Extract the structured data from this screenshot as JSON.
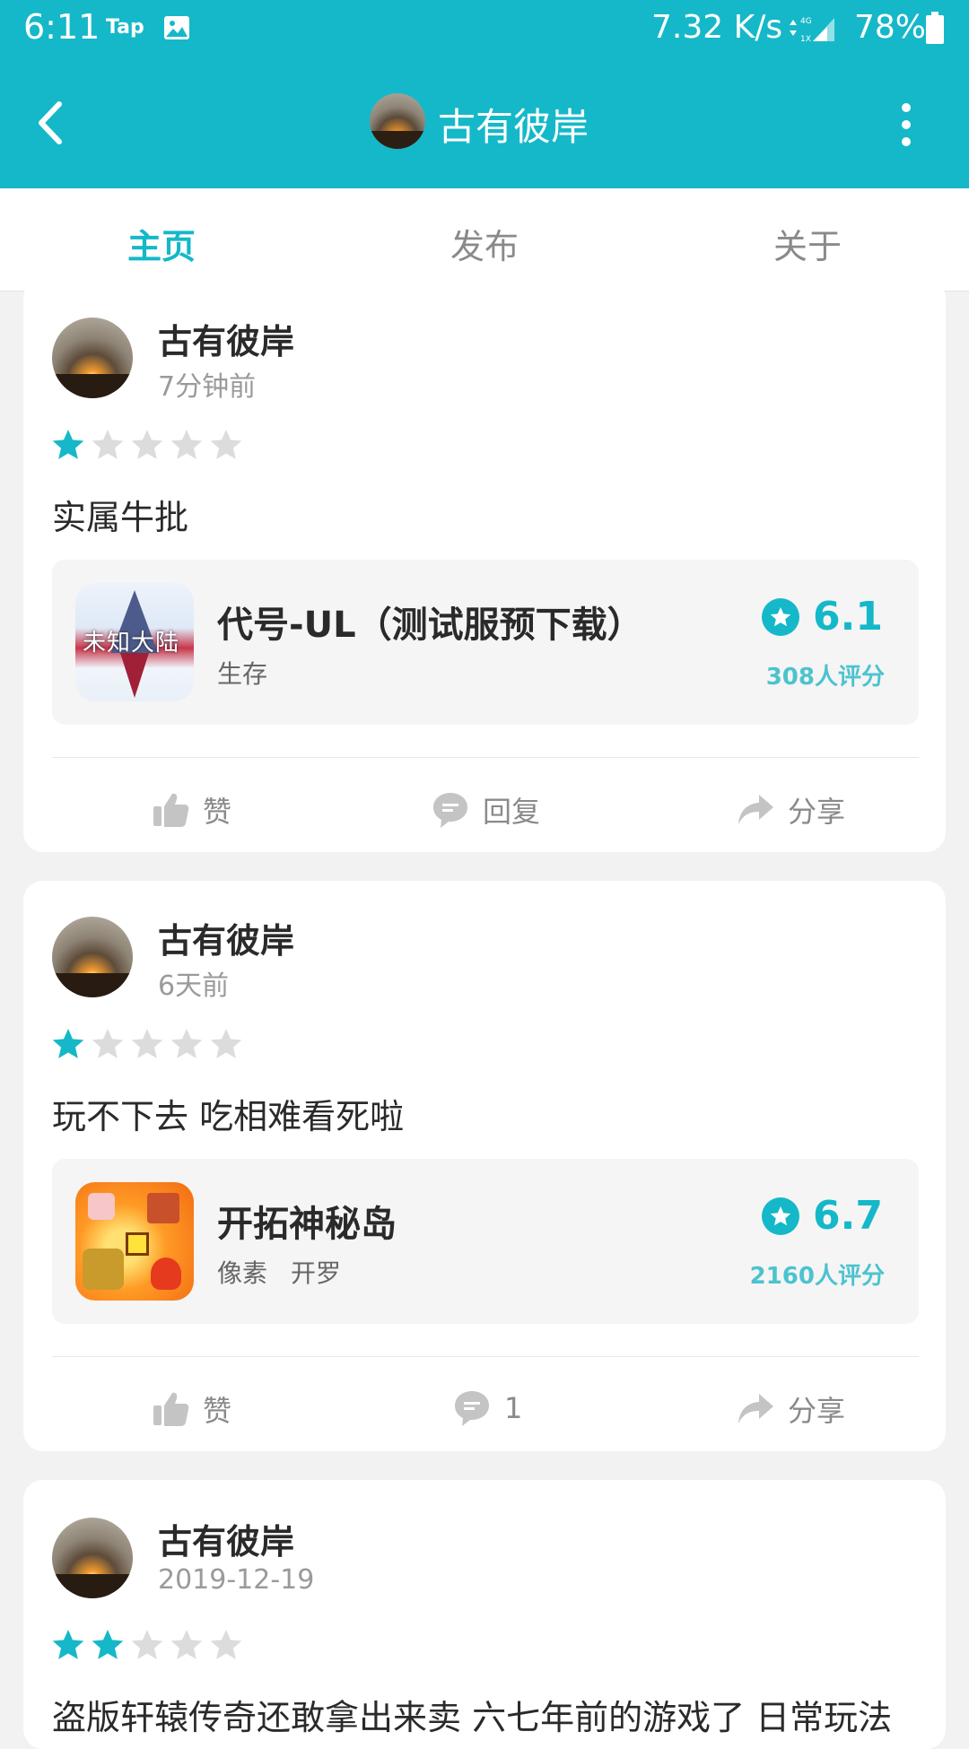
{
  "status_bar": {
    "time": "6:11",
    "tap_label": "Tap",
    "net_speed": "7.32 K/s",
    "battery": "78%",
    "icons": [
      "image-icon",
      "network-signal-icon",
      "battery-icon"
    ]
  },
  "toolbar": {
    "title": "古有彼岸",
    "icons": [
      "back-arrow-icon",
      "avatar",
      "more-vertical-icon"
    ]
  },
  "tabs": [
    {
      "label": "主页",
      "active": true
    },
    {
      "label": "发布",
      "active": false
    },
    {
      "label": "关于",
      "active": false
    }
  ],
  "colors": {
    "accent": "#15b8c8",
    "star_off": "#dcdcdc",
    "rating_count": "#4cc3cf"
  },
  "posts": [
    {
      "author": "古有彼岸",
      "time": "7分钟前",
      "rating": 1,
      "text": "实属牛批",
      "game": {
        "title": "代号-UL（测试服预下载）",
        "tags": [
          "生存"
        ],
        "score": "6.1",
        "rating_count": "308人评分",
        "icon_text": "未知大陆"
      },
      "actions": {
        "like": "赞",
        "reply": "回复",
        "share": "分享"
      }
    },
    {
      "author": "古有彼岸",
      "time": "6天前",
      "rating": 1,
      "text": "玩不下去 吃相难看死啦",
      "game": {
        "title": "开拓神秘岛",
        "tags": [
          "像素",
          "开罗"
        ],
        "score": "6.7",
        "rating_count": "2160人评分"
      },
      "actions": {
        "like": "赞",
        "reply": "1",
        "share": "分享"
      }
    },
    {
      "author": "古有彼岸",
      "time": "2019-12-19",
      "rating": 2,
      "text": "盗版轩辕传奇还敢拿出来卖 六七年前的游戏了 日常玩法"
    }
  ]
}
